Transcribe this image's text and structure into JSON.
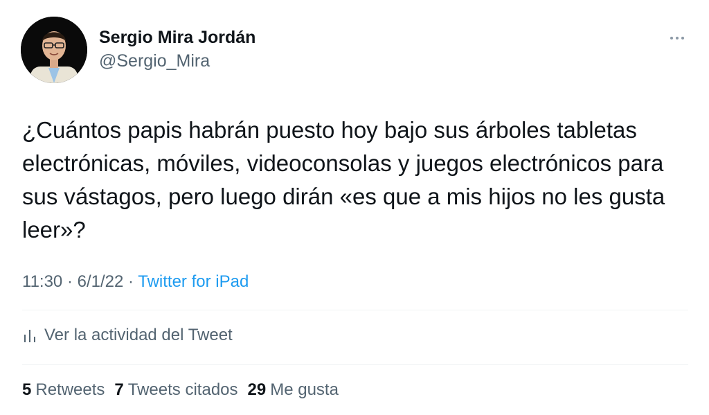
{
  "author": {
    "name": "Sergio Mira Jordán",
    "handle": "@Sergio_Mira"
  },
  "tweet": {
    "text": "¿Cuántos papis habrán puesto hoy bajo sus árboles tabletas electrónicas, móviles, videoconsolas y juegos electrónicos para sus vástagos, pero luego dirán «es que a mis hijos no les gusta leer»?"
  },
  "meta": {
    "time": "11:30",
    "separator": " · ",
    "date": "6/1/22",
    "source": "Twitter for iPad"
  },
  "activity": {
    "label": "Ver la actividad del Tweet",
    "icon": "analytics-icon"
  },
  "stats": {
    "retweets_count": "5",
    "retweets_label": "Retweets",
    "quotes_count": "7",
    "quotes_label": "Tweets citados",
    "likes_count": "29",
    "likes_label": "Me gusta"
  },
  "colors": {
    "text": "#0f1419",
    "secondary": "#536471",
    "link": "#1d9bf0",
    "divider": "#eff3f4"
  }
}
